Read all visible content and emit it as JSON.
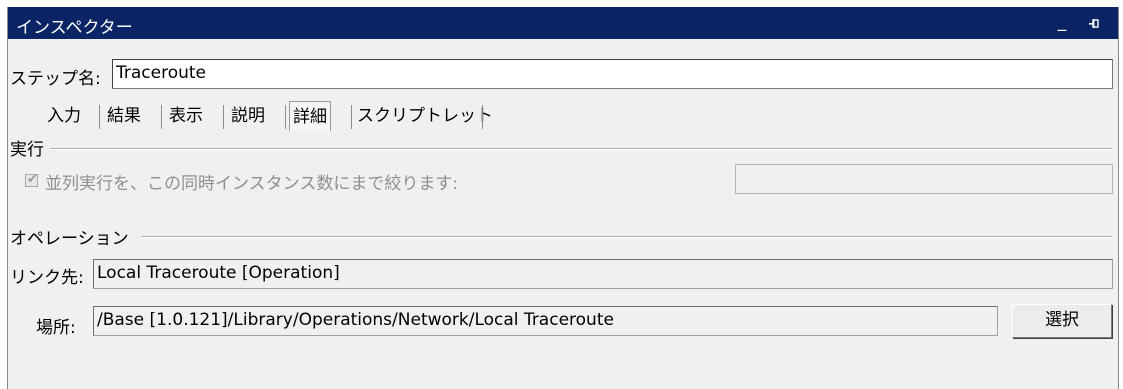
{
  "window": {
    "title": "インスペクター",
    "minimize_glyph": "_",
    "pin_icon": "pin-icon"
  },
  "step": {
    "label": "ステップ名:",
    "value": "Traceroute"
  },
  "tabs": [
    {
      "label": "入力",
      "active": false
    },
    {
      "label": "結果",
      "active": false
    },
    {
      "label": "表示",
      "active": false
    },
    {
      "label": "説明",
      "active": false
    },
    {
      "label": "詳細",
      "active": true
    },
    {
      "label": "スクリプトレット",
      "active": false
    }
  ],
  "execution": {
    "group_title": "実行",
    "checkbox_label": "並列実行を、この同時インスタンス数にまで絞ります:",
    "checked": true,
    "instance_count": ""
  },
  "operation": {
    "group_title": "オペレーション",
    "link_label": "リンク先:",
    "link_value": "Local Traceroute [Operation]",
    "location_label": "場所:",
    "location_value": "/Base [1.0.121]/Library/Operations/Network/Local Traceroute",
    "select_button": "選択"
  }
}
